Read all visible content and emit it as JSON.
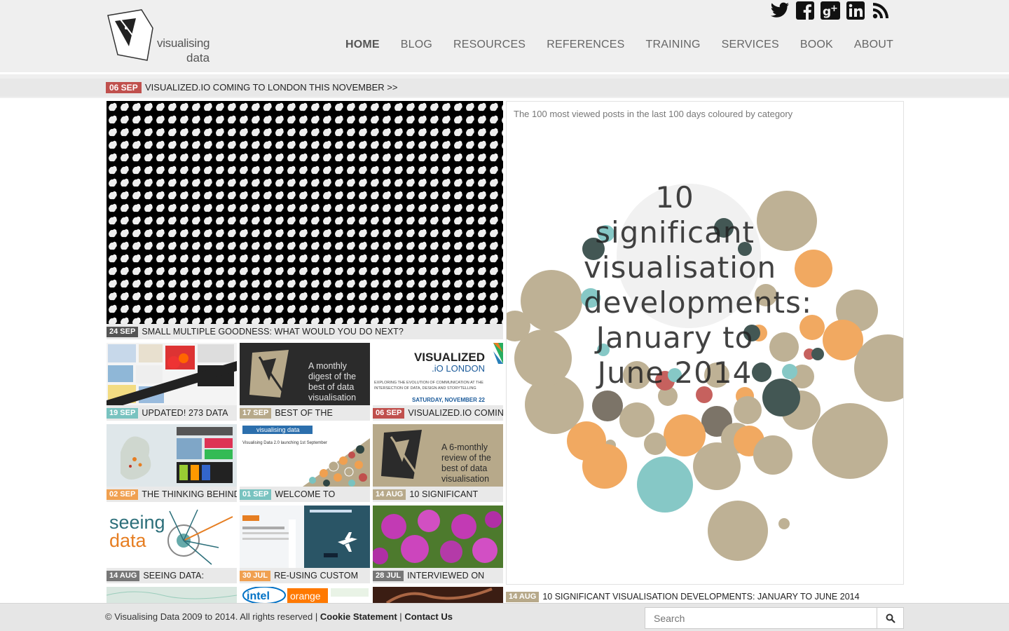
{
  "brand": {
    "line1": "visualising",
    "line2": "data"
  },
  "social": [
    "twitter-icon",
    "facebook-icon",
    "google-plus-icon",
    "linkedin-icon",
    "rss-icon"
  ],
  "nav": {
    "items": [
      "HOME",
      "BLOG",
      "RESOURCES",
      "REFERENCES",
      "TRAINING",
      "SERVICES",
      "BOOK",
      "ABOUT"
    ],
    "active": "HOME"
  },
  "ticker": {
    "date": "06 SEP",
    "text": "VISUALIZED.IO COMING TO LONDON THIS NOVEMBER >>"
  },
  "hero": {
    "date": "24 SEP",
    "title": "SMALL MULTIPLE GOODNESS: WHAT WOULD YOU DO NEXT?"
  },
  "tiles": [
    {
      "date": "19 SEP",
      "title": "UPDATED! 273 DATA"
    },
    {
      "date": "17 SEP",
      "title": "BEST OF THE",
      "overlay": [
        "A monthly",
        "digest of the",
        "best of data",
        "visualisation"
      ]
    },
    {
      "date": "06 SEP",
      "title": "VISUALIZED.IO COMING",
      "overlay": [
        "VISUALIZED",
        ".iO LONDON",
        "EXPLORING THE EVOLUTION OF COMMUNICATION AT THE",
        "INTERSECTION OF DATA, DESIGN AND STORYTELLING",
        "SATURDAY, NOVEMBER 22"
      ]
    },
    {
      "date": "02 SEP",
      "title": "THE THINKING BEHIND"
    },
    {
      "date": "01 SEP",
      "title": "WELCOME TO",
      "overlay": [
        "visualising data",
        "Visualising Data 2.0 launching 1st September"
      ]
    },
    {
      "date": "14 AUG",
      "title": "10 SIGNIFICANT",
      "overlay": [
        "A 6-monthly",
        "review of the",
        "best of data",
        "visualisation"
      ]
    },
    {
      "date": "14 AUG",
      "title": "SEEING DATA:",
      "overlay": [
        "seeing",
        "data"
      ]
    },
    {
      "date": "30 JUL",
      "title": "RE-USING CUSTOM"
    },
    {
      "date": "28 JUL",
      "title": "INTERVIEWED ON"
    }
  ],
  "feature": {
    "header": "The 100 most viewed posts in the last 100 days coloured by category",
    "headline": "10 significant visualisation developments: January to June 2014",
    "date": "14 AUG",
    "title": "10 SIGNIFICANT VISUALISATION DEVELOPMENTS: JANUARY TO JUNE 2014"
  },
  "colors": {
    "tan": "#b7a98a",
    "orange": "#f0a050",
    "teal": "#79c3c0",
    "darkgreen": "#2f4542",
    "red": "#c0504d",
    "brown": "#6e6558"
  },
  "footer": {
    "copyright": "© Visualising Data 2009 to 2014. All rights reserved |",
    "cookie": "Cookie Statement",
    "sep": "|",
    "contact": "Contact Us",
    "search_placeholder": "Search"
  }
}
